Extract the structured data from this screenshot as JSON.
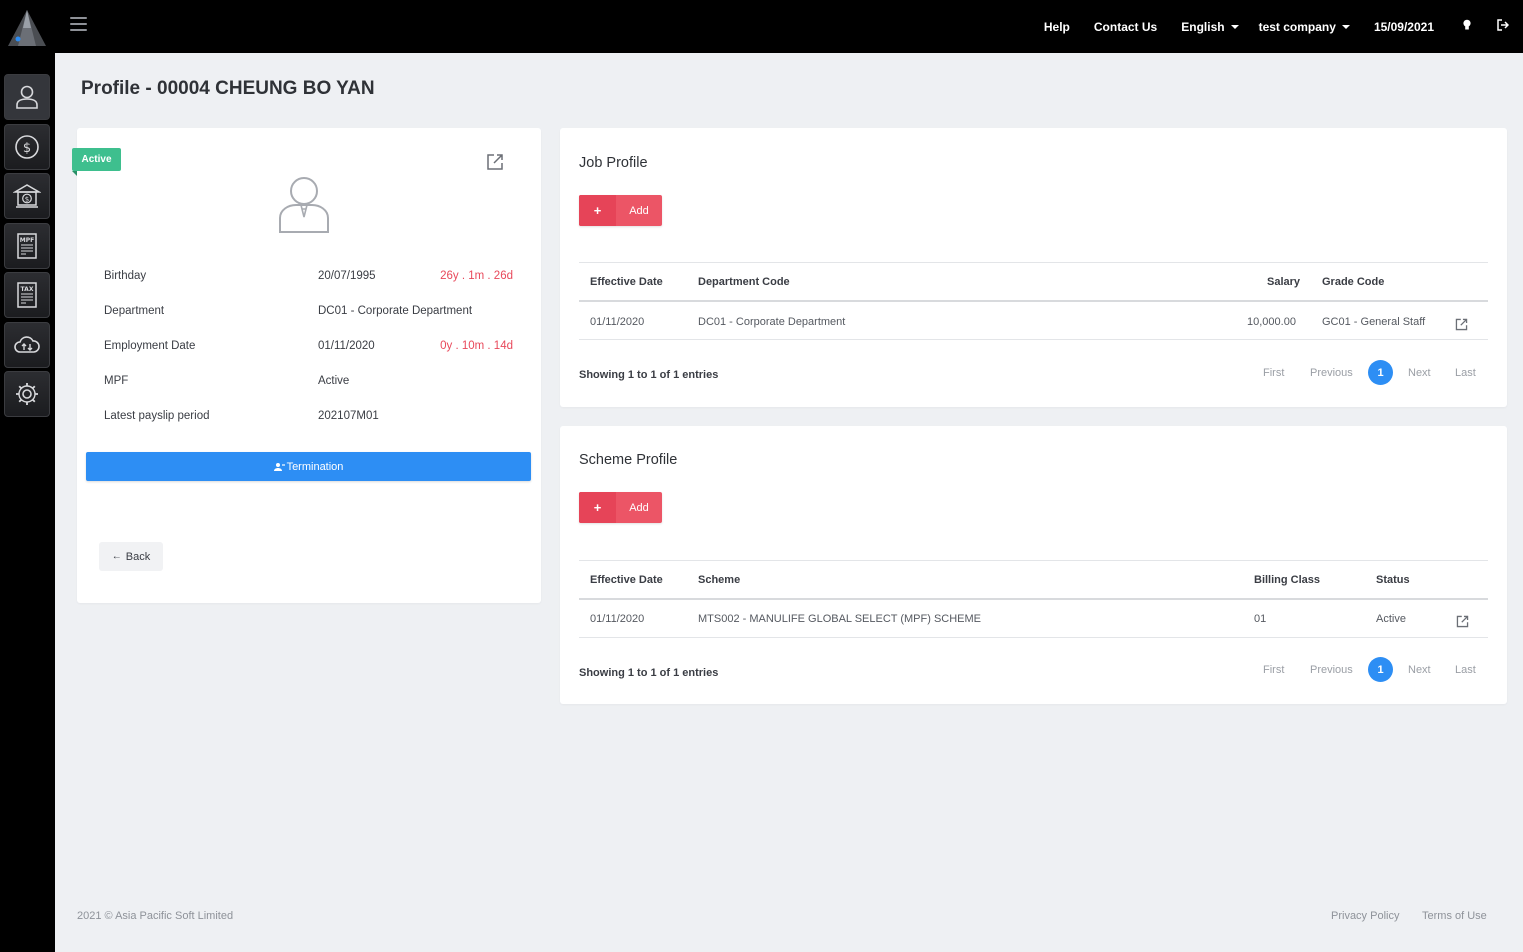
{
  "topbar": {
    "nav": {
      "help": "Help",
      "contact": "Contact Us",
      "language": "English",
      "company": "test company",
      "date": "15/09/2021"
    },
    "icons": {
      "hint": "lightbulb-icon",
      "logout": "logout-icon",
      "menu": "hamburger-icon"
    }
  },
  "sidebar": {
    "items": [
      {
        "name": "employee-icon"
      },
      {
        "name": "payroll-icon"
      },
      {
        "name": "bank-icon"
      },
      {
        "name": "mpf-icon",
        "text": "MPF"
      },
      {
        "name": "tax-icon",
        "text": "TAX"
      },
      {
        "name": "cloud-sync-icon"
      },
      {
        "name": "settings-icon"
      }
    ]
  },
  "page": {
    "title": "Profile - 00004 CHEUNG BO YAN"
  },
  "profile": {
    "status": "Active",
    "rows": [
      {
        "label": "Birthday",
        "value": "20/07/1995",
        "extra": "26y . 1m . 26d"
      },
      {
        "label": "Department",
        "value": "DC01 - Corporate Department",
        "extra": ""
      },
      {
        "label": "Employment Date",
        "value": "01/11/2020",
        "extra": "0y . 10m . 14d"
      },
      {
        "label": "MPF",
        "value": "Active",
        "extra": ""
      },
      {
        "label": "Latest payslip period",
        "value": "202107M01",
        "extra": ""
      }
    ],
    "termination_label": "Termination",
    "back_label": "Back"
  },
  "job_profile": {
    "title": "Job Profile",
    "add_label": "Add",
    "columns": [
      "Effective Date",
      "Department Code",
      "Salary",
      "Grade Code"
    ],
    "rows": [
      {
        "effective_date": "01/11/2020",
        "department": "DC01 - Corporate Department",
        "salary": "10,000.00",
        "grade": "GC01 - General Staff"
      }
    ],
    "showing": "Showing 1 to 1 of 1 entries",
    "pagination": {
      "first": "First",
      "previous": "Previous",
      "current": "1",
      "next": "Next",
      "last": "Last"
    }
  },
  "scheme_profile": {
    "title": "Scheme Profile",
    "add_label": "Add",
    "columns": [
      "Effective Date",
      "Scheme",
      "Billing Class",
      "Status"
    ],
    "rows": [
      {
        "effective_date": "01/11/2020",
        "scheme": "MTS002 - MANULIFE GLOBAL SELECT (MPF) SCHEME",
        "billing_class": "01",
        "status": "Active"
      }
    ],
    "showing": "Showing 1 to 1 of 1 entries",
    "pagination": {
      "first": "First",
      "previous": "Previous",
      "current": "1",
      "next": "Next",
      "last": "Last"
    }
  },
  "footer": {
    "copyright": "2021 © Asia Pacific Soft Limited",
    "privacy": "Privacy Policy",
    "terms": "Terms of Use"
  },
  "colors": {
    "accent_blue": "#2d8ef4",
    "add_red": "#ec5566",
    "status_green": "#3ebf8e",
    "age_red": "#e8495b"
  }
}
